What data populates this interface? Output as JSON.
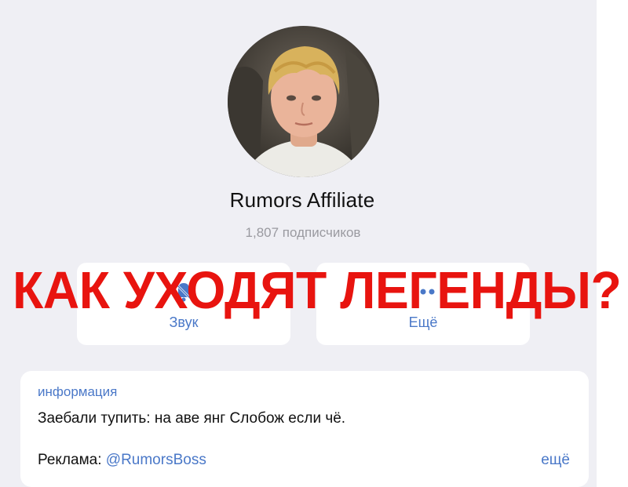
{
  "profile": {
    "channel_name": "Rumors Affiliate",
    "subscribers": "1,807 подписчиков"
  },
  "actions": {
    "sound_label": "Звук",
    "more_label": "Ещё",
    "sound_icon": "bell-muted-icon",
    "more_icon": "more-dots-icon"
  },
  "info": {
    "title": "информация",
    "description": "Заебали тупить: на аве янг Слобож если чё.",
    "ad_prefix": "Реклама: ",
    "ad_link": "@RumorsBoss",
    "more_link": "ещё"
  },
  "overlay": {
    "headline": "КАК УХОДЯТ ЛЕГЕНДЫ?"
  },
  "colors": {
    "accent": "#4a78c8",
    "headline": "#e8140f",
    "background": "#efeff4"
  }
}
